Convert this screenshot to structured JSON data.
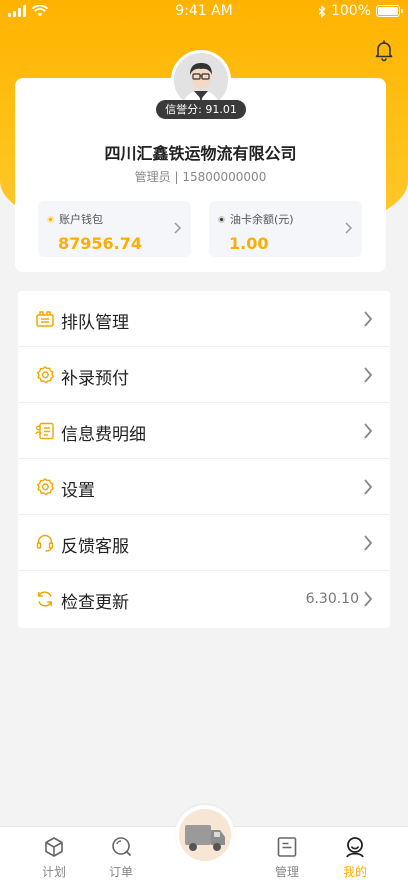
{
  "status_bar": {
    "time": "9:41 AM",
    "battery": "100%"
  },
  "profile": {
    "credit_label": "信誉分: 91.01",
    "company": "四川汇鑫铁运物流有限公司",
    "role": "管理员 | 15800000000"
  },
  "wallets": [
    {
      "label": "账户钱包",
      "amount": "87956.74",
      "dot_color": "#ffad00"
    },
    {
      "label": "油卡余额(元)",
      "amount": "1.00",
      "dot_color": "#333333"
    }
  ],
  "menu": [
    {
      "label": "排队管理",
      "icon": "queue-icon"
    },
    {
      "label": "补录预付",
      "icon": "gear-icon"
    },
    {
      "label": "信息费明细",
      "icon": "info-fee-icon"
    },
    {
      "label": "设置",
      "icon": "gear-icon"
    },
    {
      "label": "反馈客服",
      "icon": "headset-icon"
    },
    {
      "label": "检查更新",
      "icon": "refresh-icon",
      "value": "6.30.10"
    }
  ],
  "tabs": [
    {
      "label": "计划",
      "icon": "box-icon"
    },
    {
      "label": "订单",
      "icon": "search-icon"
    },
    {
      "label": "管理",
      "icon": "list-icon"
    },
    {
      "label": "我的",
      "icon": "user-icon",
      "active": true
    }
  ],
  "colors": {
    "accent": "#ffad00",
    "header": "#ffb300"
  }
}
